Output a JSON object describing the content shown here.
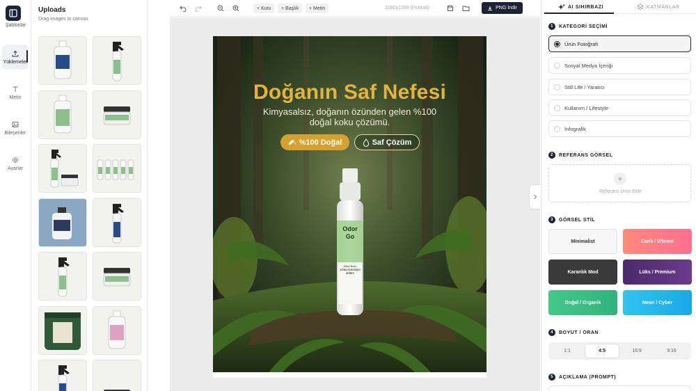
{
  "nav": {
    "logo_label": "Şablonlar",
    "items": [
      {
        "label": "Yüklemeler",
        "icon": "upload-icon"
      },
      {
        "label": "Metin",
        "icon": "text-icon"
      },
      {
        "label": "Bileşenler",
        "icon": "image-icon"
      },
      {
        "label": "Ayarlar",
        "icon": "gear-icon"
      }
    ]
  },
  "uploads": {
    "title": "Uploads",
    "subtitle": "Drag images to canvas"
  },
  "toolbar": {
    "add_box": "+ Kutu",
    "add_heading": "+ Başlık",
    "add_text": "+ Metin",
    "dimensions": "1080x1350 (Portrait)",
    "download": "PNG İndir"
  },
  "poster": {
    "title": "Doğanın Saf Nefesi",
    "subtitle": "Kimyasalsız, doğanın özünden gelen %100 doğal koku çözümü.",
    "badge1": "%100 Doğal",
    "badge2": "Saf Çözüm",
    "brand_top": "Odor",
    "brand_bottom": "Go",
    "bottle_line1": "Sirke Bazlı",
    "bottle_line2": "KOKU YOK EDİCİ",
    "bottle_line3": "SPREY"
  },
  "panel": {
    "tab_ai": "AI SIHIRBAZI",
    "tab_layers": "KATMANLAR",
    "section1": {
      "num": "1",
      "title": "KATEGORİ SEÇİMİ"
    },
    "categories": [
      "Ürün Fotoğrafı",
      "Sosyal Medya İçeriği",
      "Still Life / Yaratıcı",
      "Kullanım / Lifestyle",
      "İnfografik"
    ],
    "section2": {
      "num": "2",
      "title": "REFERANS GÖRSEL"
    },
    "ref_label": "Referans Ürün Ekle",
    "section3": {
      "num": "3",
      "title": "GÖRSEL STİL"
    },
    "styles": [
      "Minimalist",
      "Canlı / Vibrant",
      "Karanlık Mod",
      "Lüks / Premium",
      "Doğal / Organik",
      "Neon / Cyber"
    ],
    "section4": {
      "num": "4",
      "title": "BOYUT / ORAN"
    },
    "ratios": [
      "1:1",
      "4:5",
      "16:9",
      "9:16"
    ],
    "section5": {
      "num": "5",
      "title": "AÇIKLAMA (PROMPT)"
    }
  },
  "colors": {
    "accent": "#1e2235",
    "poster_title": "#e3b43c",
    "badge_gold": "#d7a12e"
  }
}
